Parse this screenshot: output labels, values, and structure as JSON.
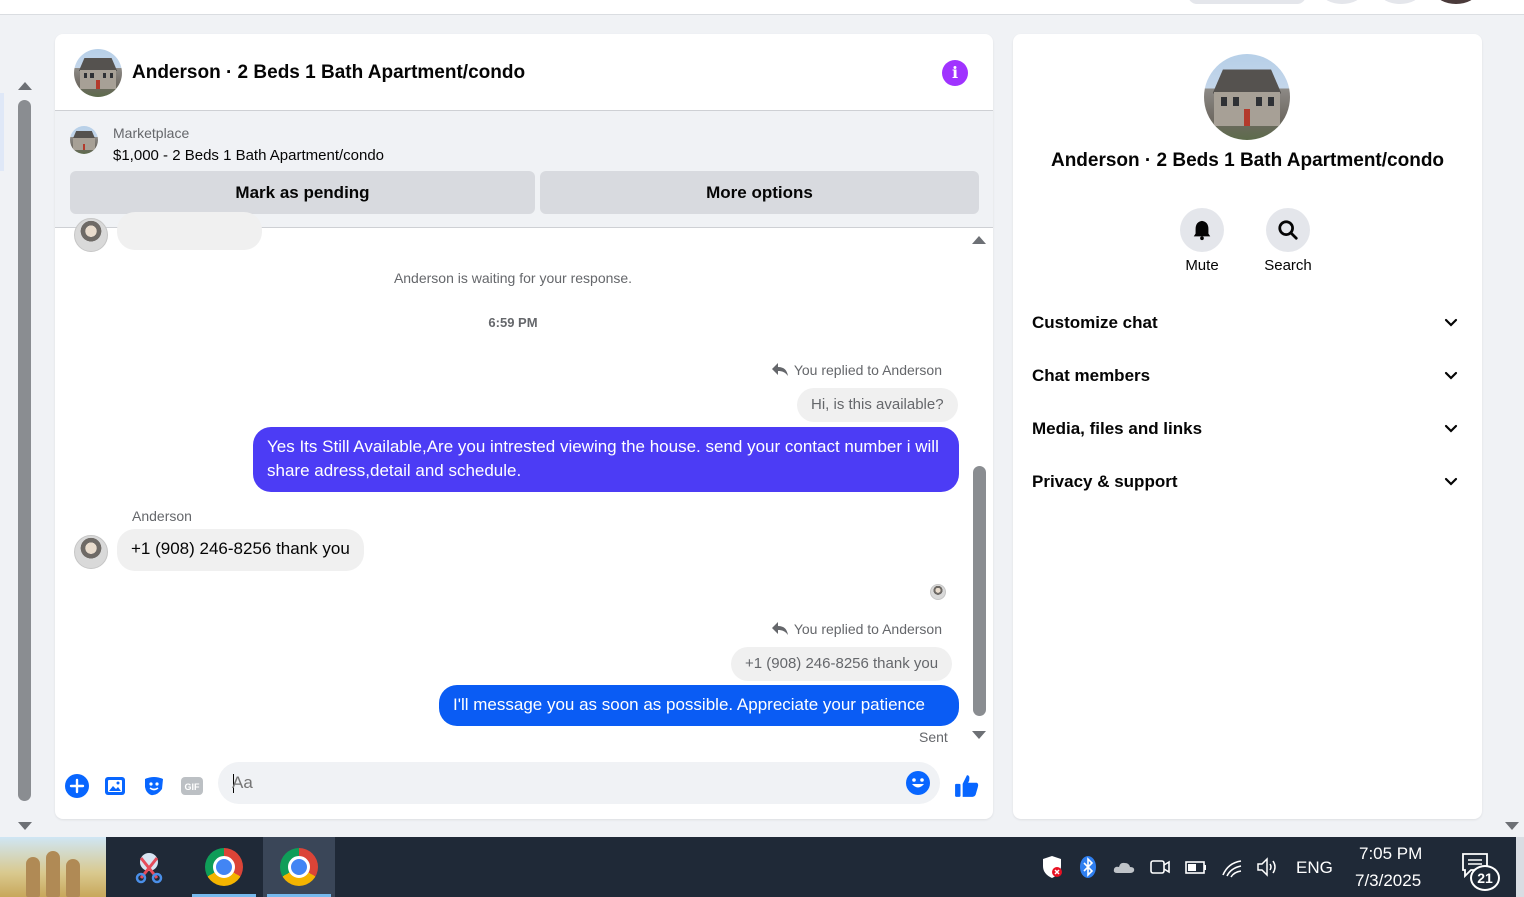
{
  "chat": {
    "title": "Anderson · 2 Beds 1 Bath Apartment/condo",
    "marketplace": {
      "label": "Marketplace",
      "listing": "$1,000 - 2 Beds 1 Bath Apartment/condo",
      "pending_button": "Mark as pending",
      "more_button": "More options"
    },
    "messages": {
      "waiting_notice": "Anderson is waiting for your response.",
      "timestamp": "6:59 PM",
      "reply_hint_1": "You replied to Anderson",
      "quoted_1": "Hi, is this available?",
      "sent_1": "Yes Its Still Available,Are you intrested viewing the house. send your contact number i will share adress,detail and schedule.",
      "sender_name": "Anderson",
      "received_1": "+1 (908) 246-8256 thank you",
      "reply_hint_2": "You replied to Anderson",
      "quoted_2": "+1 (908) 246-8256 thank you",
      "sent_2": "I'll message you as soon as possible. Appreciate your patience",
      "status": "Sent"
    },
    "composer": {
      "placeholder": "Aa"
    },
    "colors": {
      "bubble_sent_1": "#4c3cf5",
      "bubble_sent_2": "#0a5cf4",
      "info_icon": "#a033ff",
      "accent": "#0866ff"
    }
  },
  "info_panel": {
    "title": "Anderson · 2 Beds 1 Bath Apartment/condo",
    "actions": [
      {
        "label": "Mute",
        "icon": "bell-icon"
      },
      {
        "label": "Search",
        "icon": "search-icon"
      }
    ],
    "sections": [
      {
        "label": "Customize chat"
      },
      {
        "label": "Chat members"
      },
      {
        "label": "Media, files and links"
      },
      {
        "label": "Privacy & support"
      }
    ]
  },
  "taskbar": {
    "language": "ENG",
    "time": "7:05 PM",
    "date": "7/3/2025",
    "notification_count": "21"
  }
}
